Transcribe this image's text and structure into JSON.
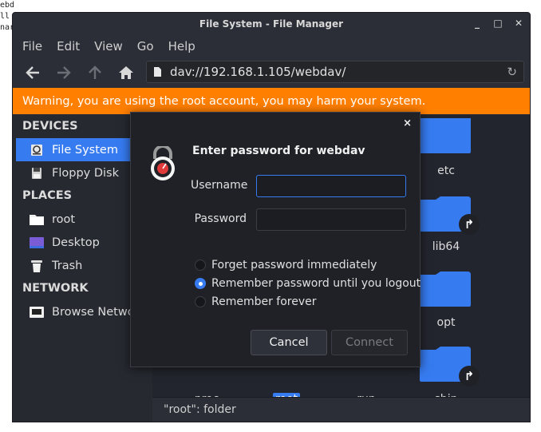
{
  "background_terminal": [
    "ebd",
    "ll",
    "nar"
  ],
  "window": {
    "title": "File System - File Manager",
    "controls": {
      "minimize": "_",
      "maximize": "□",
      "close": "✕"
    }
  },
  "menu": [
    "File",
    "Edit",
    "View",
    "Go",
    "Help"
  ],
  "toolbar": {
    "address": "dav://192.168.1.105/webdav/"
  },
  "warning": "Warning, you are using the root account, you may harm your system.",
  "sidebar": {
    "devices_header": "DEVICES",
    "devices": [
      {
        "label": "File System",
        "icon": "drive-icon",
        "selected": true
      },
      {
        "label": "Floppy Disk",
        "icon": "floppy-icon"
      }
    ],
    "places_header": "PLACES",
    "places": [
      {
        "label": "root",
        "icon": "folder-icon"
      },
      {
        "label": "Desktop",
        "icon": "desktop-icon"
      },
      {
        "label": "Trash",
        "icon": "trash-icon"
      }
    ],
    "network_header": "NETWORK",
    "network": [
      {
        "label": "Browse Network",
        "icon": "network-icon"
      }
    ]
  },
  "files": {
    "right_column": [
      "etc",
      "lib64",
      "opt"
    ],
    "bottom_row": [
      "proc",
      "root",
      "run",
      "sbin"
    ]
  },
  "status": "\"root\": folder",
  "dialog": {
    "close": "×",
    "title": "Enter password for webdav",
    "username_label": "Username",
    "username_value": "",
    "password_label": "Password",
    "password_value": "",
    "options": [
      {
        "label": "Forget password immediately",
        "selected": false
      },
      {
        "label": "Remember password until you logout",
        "selected": true
      },
      {
        "label": "Remember forever",
        "selected": false
      }
    ],
    "cancel": "Cancel",
    "connect": "Connect"
  },
  "colors": {
    "accent": "#367bf0",
    "warning": "#ff7f00",
    "folder": "#367bf0"
  }
}
